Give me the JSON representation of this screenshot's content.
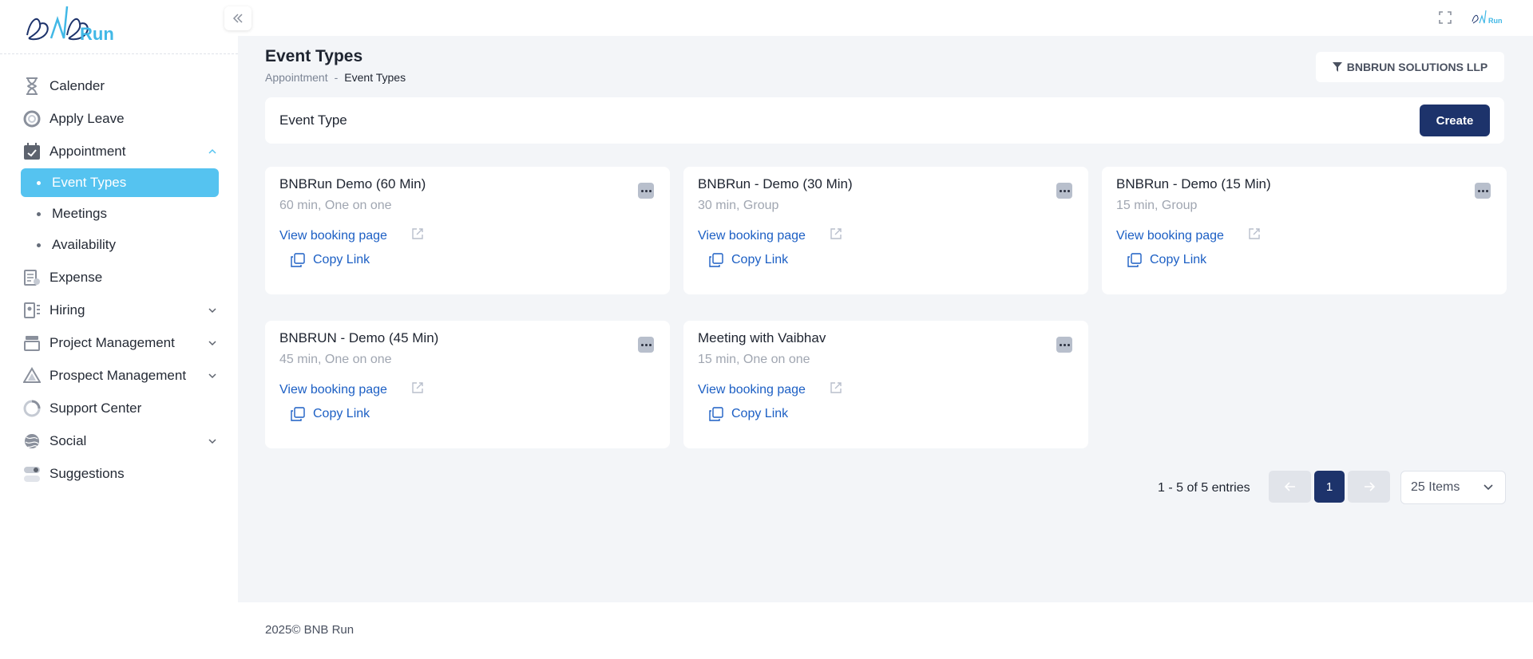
{
  "app": {
    "logo_word": "Run",
    "top_logo_text": "Run",
    "accent_color": "#55c3f0",
    "primary_color": "#1d336b",
    "link_color": "#1c5fc4"
  },
  "sidebar": {
    "items": [
      {
        "label": "Calender",
        "icon": "hourglass-icon"
      },
      {
        "label": "Apply Leave",
        "icon": "lifebuoy-icon"
      },
      {
        "label": "Appointment",
        "icon": "calendar-check-icon",
        "expanded": true
      },
      {
        "label": "Expense",
        "icon": "receipt-icon"
      },
      {
        "label": "Hiring",
        "icon": "id-card-icon",
        "has_children": true
      },
      {
        "label": "Project Management",
        "icon": "folder-stack-icon",
        "has_children": true
      },
      {
        "label": "Prospect Management",
        "icon": "triangle-icon",
        "has_children": true
      },
      {
        "label": "Support Center",
        "icon": "pie-icon"
      },
      {
        "label": "Social",
        "icon": "globe-icon",
        "has_children": true
      },
      {
        "label": "Suggestions",
        "icon": "toggle-icon"
      }
    ],
    "appointment_sub": [
      {
        "label": "Event Types",
        "active": true
      },
      {
        "label": "Meetings"
      },
      {
        "label": "Availability"
      }
    ]
  },
  "page": {
    "title": "Event Types",
    "breadcrumb": [
      "Appointment",
      "-",
      "Event Types"
    ],
    "org_filter": "BNBRUN SOLUTIONS LLP"
  },
  "header_card": {
    "label": "Event Type",
    "create_label": "Create"
  },
  "cards": [
    {
      "title": "BNBRun Demo (60 Min)",
      "subtitle": "60 min, One on one",
      "view": "View booking page",
      "copy": "Copy Link"
    },
    {
      "title": "BNBRun - Demo (30 Min)",
      "subtitle": "30 min, Group",
      "view": "View booking page",
      "copy": "Copy Link"
    },
    {
      "title": "BNBRun - Demo (15 Min)",
      "subtitle": "15 min, Group",
      "view": "View booking page",
      "copy": "Copy Link"
    },
    {
      "title": "BNBRUN - Demo (45 Min)",
      "subtitle": "45 min, One on one",
      "view": "View booking page",
      "copy": "Copy Link"
    },
    {
      "title": "Meeting with Vaibhav",
      "subtitle": "15 min, One on one",
      "view": "View booking page",
      "copy": "Copy Link"
    }
  ],
  "pagination": {
    "entries_text": "1 - 5 of 5 entries",
    "current_page": "1",
    "page_size": "25 Items"
  },
  "footer": {
    "text": "2025© BNB Run"
  }
}
